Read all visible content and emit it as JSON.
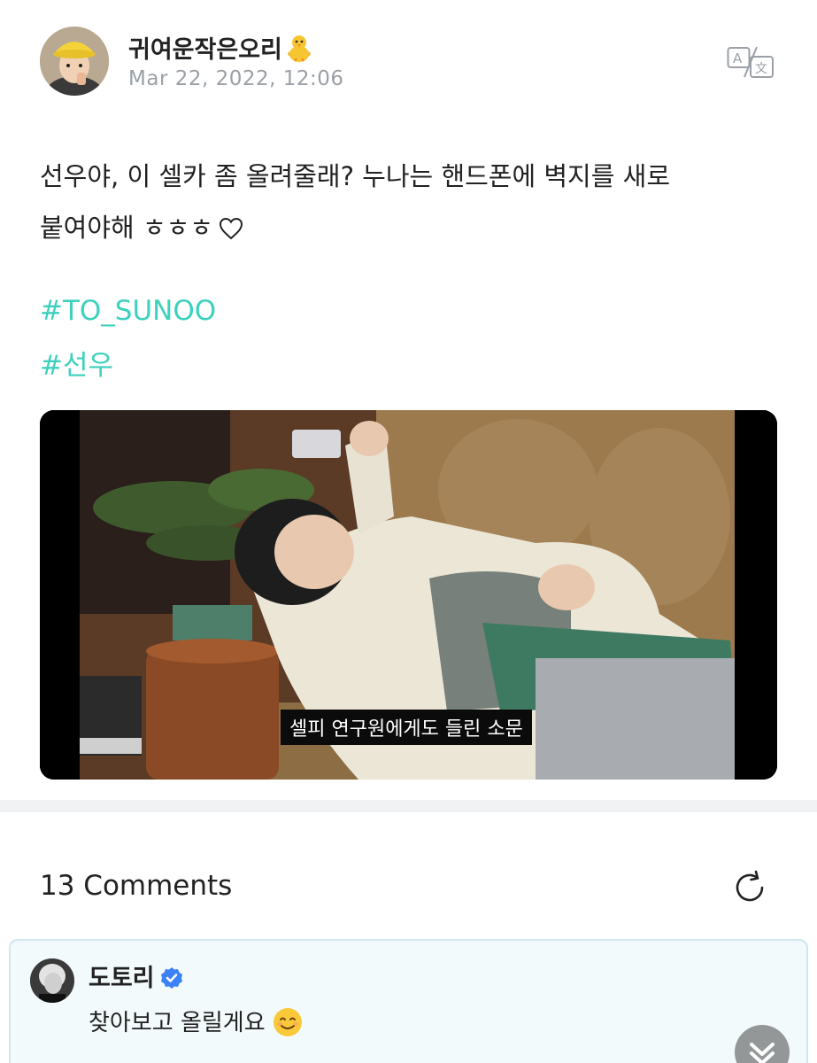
{
  "post": {
    "author": "귀여운작은오리",
    "author_emoji_icon": "baby-chick-icon",
    "timestamp": "Mar 22, 2022, 12:06",
    "body_line1": "선우야, 이 셀카 좀 올려줄래? 누나는 핸드폰에 벽지를 새로",
    "body_line2": "붙여야해 ㅎㅎㅎ",
    "body_trailing_icon": "heart-outline-icon",
    "hashtags": [
      "#TO_SUNOO",
      "#선우"
    ],
    "media_subtitle": "셀피 연구원에게도 들린 소문",
    "translate_icon": "translate-icon"
  },
  "comments": {
    "title": "13 Comments",
    "refresh_icon": "refresh-icon",
    "items": [
      {
        "author": "도토리",
        "verified": true,
        "text": "찾아보고 올릴게요",
        "emoji_icon": "smiling-face-icon"
      }
    ]
  },
  "colors": {
    "hashtag": "#3ed1bd",
    "timestamp": "#9aa0a6",
    "verified": "#3b82f6",
    "comment_bg": "#f3fafc",
    "comment_border": "#cfe7ee"
  }
}
